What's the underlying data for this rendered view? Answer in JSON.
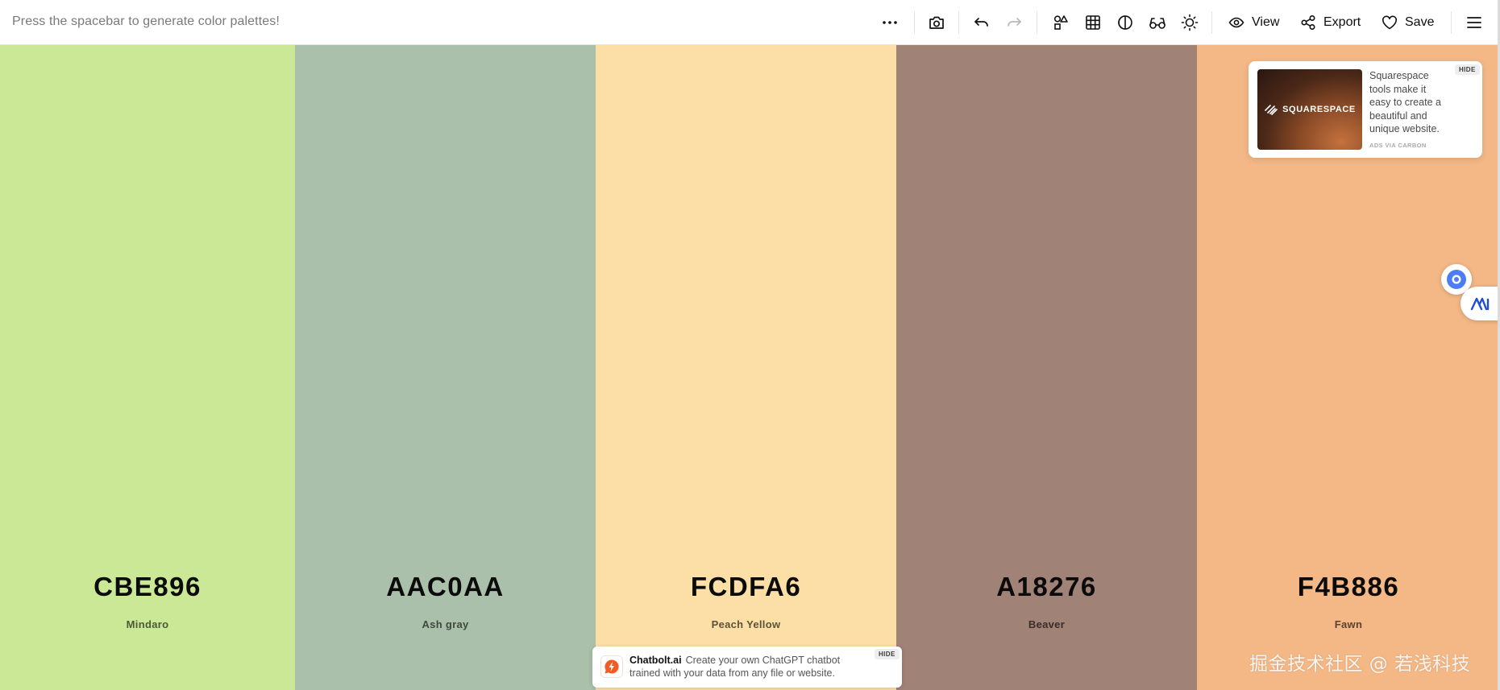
{
  "toolbar": {
    "hint": "Press the spacebar to generate color palettes!",
    "view_label": "View",
    "export_label": "Export",
    "save_label": "Save"
  },
  "palette": [
    {
      "hex": "CBE896",
      "name": "Mindaro",
      "color": "#CBE896",
      "name_color": "#4a5a38"
    },
    {
      "hex": "AAC0AA",
      "name": "Ash gray",
      "color": "#AAC0AA",
      "name_color": "#3d4a3d"
    },
    {
      "hex": "FCDFA6",
      "name": "Peach Yellow",
      "color": "#FCDFA6",
      "name_color": "#5d5238"
    },
    {
      "hex": "A18276",
      "name": "Beaver",
      "color": "#A18276",
      "name_color": "#3a2c27"
    },
    {
      "hex": "F4B886",
      "name": "Fawn",
      "color": "#F4B886",
      "name_color": "#5c4230"
    }
  ],
  "ads": {
    "squarespace": {
      "brand": "SQUARESPACE",
      "text": "Squarespace tools make it easy to create a beautiful and unique website.",
      "via": "ADS VIA CARBON",
      "hide": "HIDE"
    },
    "chatbolt": {
      "brand": "Chatbolt.ai",
      "text": "Create your own ChatGPT chatbot trained with your data from any file or website.",
      "hide": "HIDE"
    }
  },
  "watermark": "掘金技术社区 @ 若浅科技",
  "icons": [
    "more-icon",
    "camera-icon",
    "undo-icon",
    "redo-icon",
    "shapes-icon",
    "grid-icon",
    "contrast-icon",
    "glasses-icon",
    "sun-icon",
    "eye-icon",
    "share-icon",
    "heart-icon",
    "menu-icon"
  ]
}
